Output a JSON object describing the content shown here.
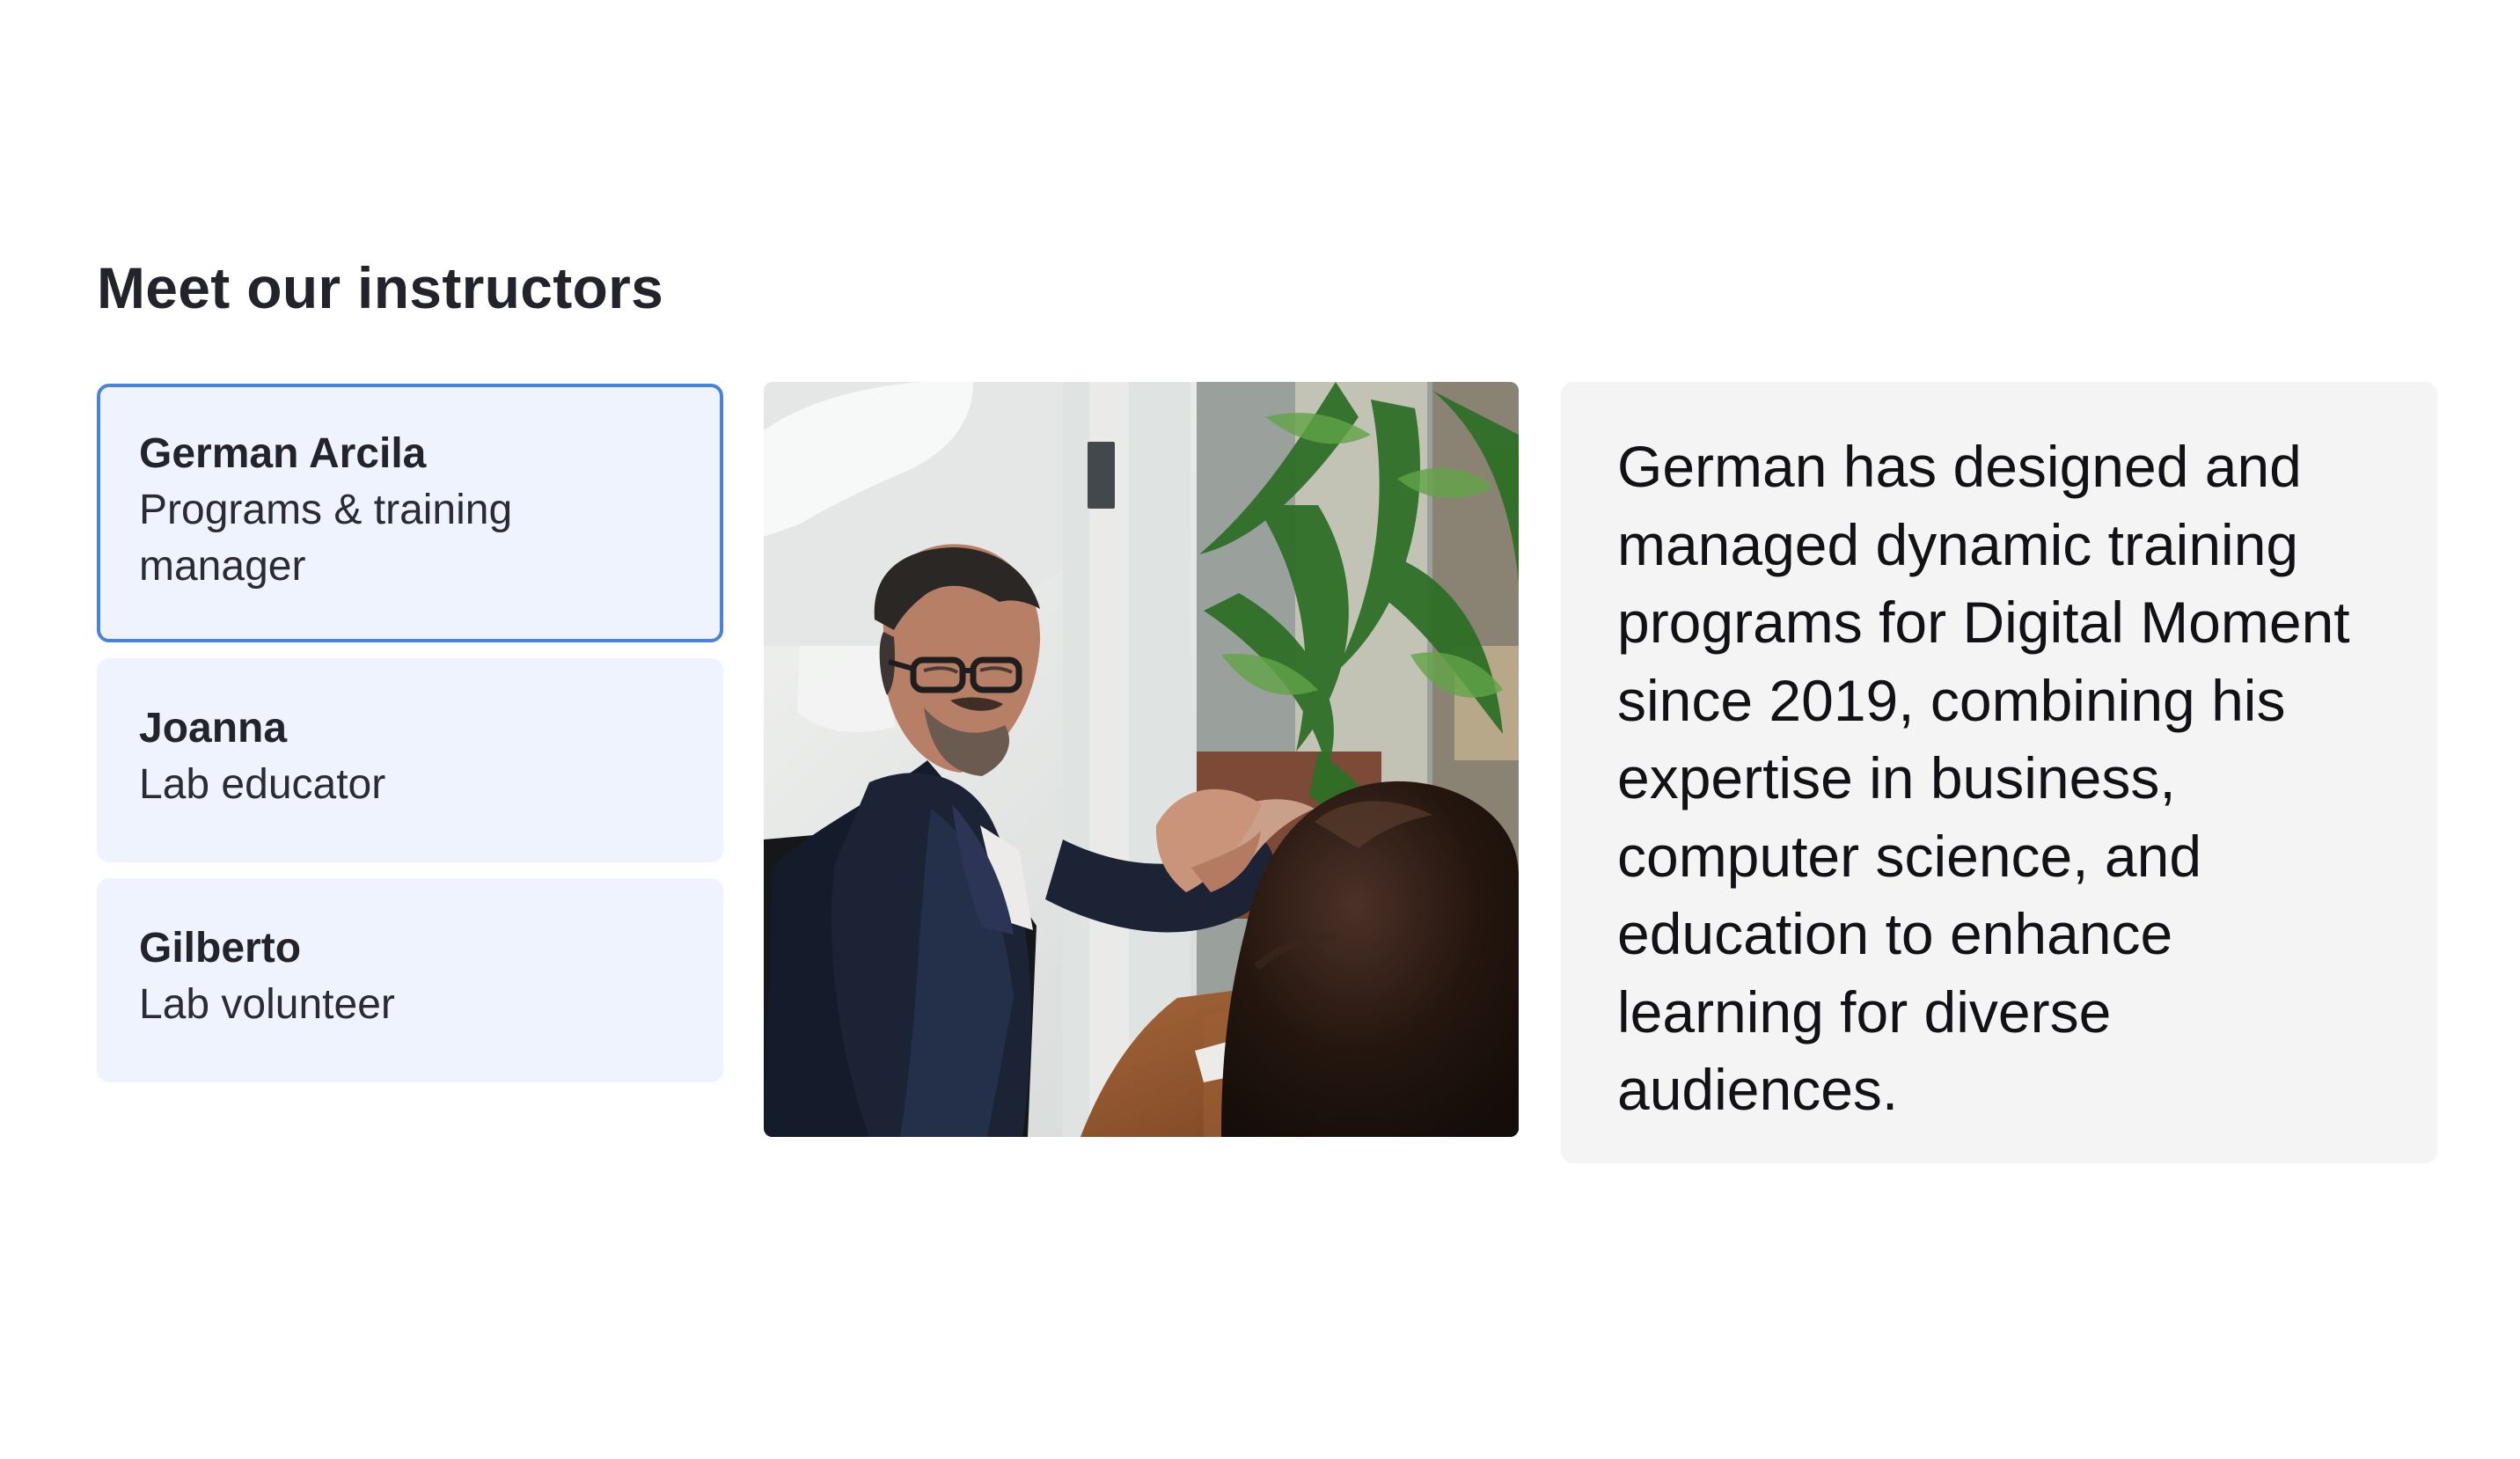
{
  "section": {
    "title": "Meet our instructors"
  },
  "instructors": [
    {
      "name": "German Arcila",
      "role": "Programs & training manager",
      "selected": true
    },
    {
      "name": "Joanna",
      "role": "Lab educator",
      "selected": false
    },
    {
      "name": "Gilberto",
      "role": "Lab volunteer",
      "selected": false
    }
  ],
  "bio": {
    "text": "German has designed and managed dynamic training programs for Digital Moment since 2019, combining his expertise in business, computer science, and education to enhance learning for diverse audiences."
  },
  "colors": {
    "card_background": "#eef3fd",
    "selected_border": "#4a82db",
    "bio_background": "#f4f4f4",
    "heading_text": "#23232b"
  }
}
